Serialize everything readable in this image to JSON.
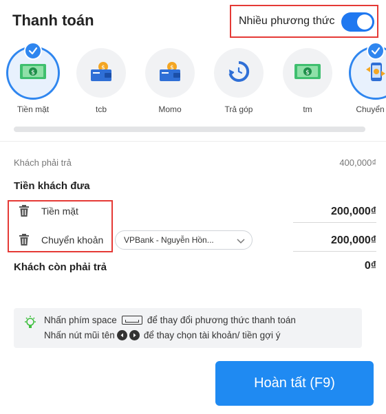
{
  "header": {
    "title": "Thanh toán",
    "multi_label": "Nhiều phương thức",
    "multi_enabled": true
  },
  "methods": [
    {
      "label": "Tiền mặt",
      "icon": "cash-icon",
      "selected": true
    },
    {
      "label": "tcb",
      "icon": "wallet-icon",
      "selected": false
    },
    {
      "label": "Momo",
      "icon": "wallet-icon",
      "selected": false
    },
    {
      "label": "Trả góp",
      "icon": "installment-icon",
      "selected": false
    },
    {
      "label": "tm",
      "icon": "cash-icon",
      "selected": false
    },
    {
      "label": "Chuyển kh",
      "icon": "phone-transfer-icon",
      "selected": true
    }
  ],
  "summary": {
    "customer_must_pay_label": "Khách phải trả",
    "customer_must_pay_value": "400,000₫",
    "customer_given_title": "Tiền khách đưa",
    "payments": [
      {
        "label": "Tiền mặt",
        "amount": "200,000₫"
      },
      {
        "label": "Chuyển khoản",
        "amount": "200,000₫",
        "account": "VPBank - Nguyễn Hồn..."
      }
    ],
    "remaining_label": "Khách còn phải trả",
    "remaining_value": "0₫"
  },
  "hint": {
    "line1_prefix": "Nhấn phím space",
    "line1_suffix": "để thay đổi phương thức thanh toán",
    "line2_prefix": "Nhấn nút mũi tên",
    "line2_suffix": "để thay chọn tài khoản/ tiền gợi ý"
  },
  "actions": {
    "done_label": "Hoàn tất (F9)"
  },
  "colors": {
    "accent": "#1f8af2",
    "highlight_border": "#e53935",
    "cash_green": "#3fbf6f",
    "wallet_blue": "#2f6fd6",
    "coin_orange": "#f4a623"
  }
}
